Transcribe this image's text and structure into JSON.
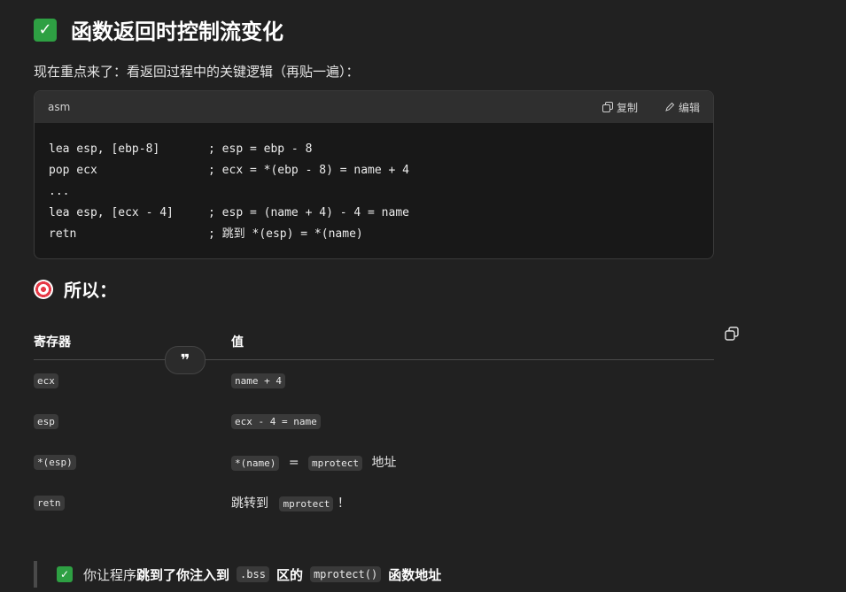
{
  "heading": {
    "emoji": "✅",
    "title": "函数返回时控制流变化"
  },
  "intro": "现在重点来了：看返回过程中的关键逻辑（再贴一遍）：",
  "code": {
    "lang": "asm",
    "copy_label": "复制",
    "edit_label": "编辑",
    "lines": [
      "lea esp, [ebp-8]       ; esp = ebp - 8",
      "pop ecx                ; ecx = *(ebp - 8) = name + 4",
      "...",
      "lea esp, [ecx - 4]     ; esp = (name + 4) - 4 = name",
      "retn                   ; 跳到 *(esp) = *(name)"
    ]
  },
  "subheading": {
    "icon": "target-icon",
    "title": "所以："
  },
  "table": {
    "headers": [
      "寄存器",
      "值"
    ],
    "rows": [
      {
        "reg": "ecx",
        "val_code": "name + 4"
      },
      {
        "reg": "esp",
        "val_code": "ecx - 4 = name"
      },
      {
        "reg": "*(esp)",
        "val_code1": "*(name)",
        "eq": "=",
        "val_code2": "mprotect",
        "suffix": "地址"
      },
      {
        "reg": "retn",
        "prefix": "跳转到",
        "val_code": "mprotect",
        "suffix": "！"
      }
    ]
  },
  "quote_button": "❞",
  "blockquote": {
    "emoji": "✅",
    "text1": "你让程序",
    "bold1": "跳到了你注入到",
    "code1": ".bss",
    "bold2": "区的",
    "code2": "mprotect()",
    "bold3": "函数地址"
  }
}
